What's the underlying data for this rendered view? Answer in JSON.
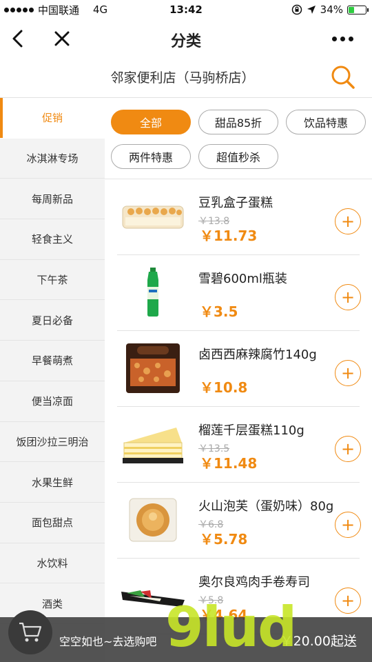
{
  "status_bar": {
    "carrier": "中国联通",
    "network": "4G",
    "time": "13:42",
    "battery": "34%",
    "battery_level": 0.34
  },
  "nav": {
    "title": "分类"
  },
  "store": {
    "name": "邻家便利店（马驹桥店）"
  },
  "sidebar": {
    "items": [
      {
        "label": "促销"
      },
      {
        "label": "冰淇淋专场"
      },
      {
        "label": "每周新品"
      },
      {
        "label": "轻食主义"
      },
      {
        "label": "下午茶"
      },
      {
        "label": "夏日必备"
      },
      {
        "label": "早餐萌煮"
      },
      {
        "label": "便当凉面"
      },
      {
        "label": "饭团沙拉三明治"
      },
      {
        "label": "水果生鲜"
      },
      {
        "label": "面包甜点"
      },
      {
        "label": "水饮料"
      },
      {
        "label": "酒类"
      }
    ]
  },
  "filters": [
    {
      "label": "全部"
    },
    {
      "label": "甜品85折"
    },
    {
      "label": "饮品特惠"
    },
    {
      "label": "两件特惠"
    },
    {
      "label": "超值秒杀"
    }
  ],
  "products": [
    {
      "name": "豆乳盒子蛋糕",
      "old_price": "￥13.8",
      "price": "￥11.73"
    },
    {
      "name": "雪碧600ml瓶装",
      "old_price": "",
      "price": "￥3.5"
    },
    {
      "name": "卤西西麻辣腐竹140g",
      "old_price": "",
      "price": "￥10.8"
    },
    {
      "name": "榴莲千层蛋糕110g",
      "old_price": "￥13.5",
      "price": "￥11.48"
    },
    {
      "name": "火山泡芙（蛋奶味）80g",
      "old_price": "￥6.8",
      "price": "￥5.78"
    },
    {
      "name": "奥尔良鸡肉手卷寿司",
      "old_price": "￥5.8",
      "price": "￥4.64"
    }
  ],
  "cart": {
    "empty_text": "空空如也~去选购吧",
    "min_order": "￥20.00起送"
  },
  "watermark": "9lud",
  "colors": {
    "accent": "#f08a12"
  }
}
